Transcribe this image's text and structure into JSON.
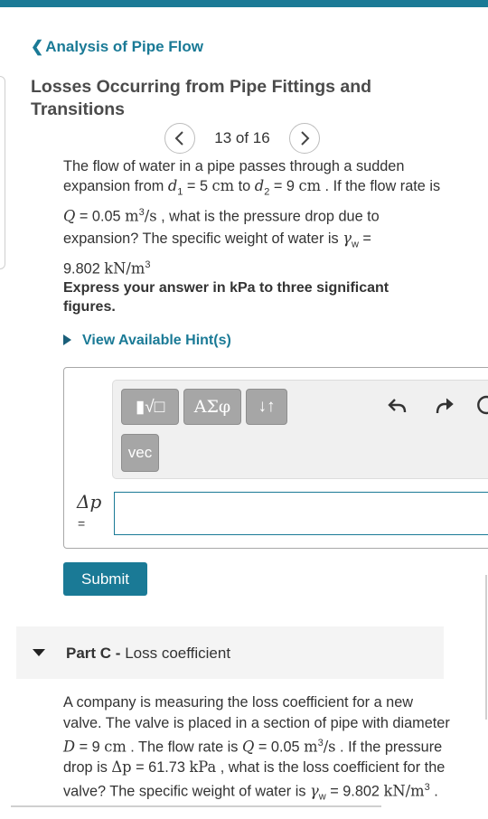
{
  "nav": {
    "back_label": "Analysis of Pipe Flow"
  },
  "page": {
    "title": "Losses Occurring from Pipe Fittings and Transitions"
  },
  "pager": {
    "count": "13 of 16",
    "prev_icon": "chevron-left-icon",
    "next_icon": "chevron-right-icon"
  },
  "problem": {
    "line1": "The flow of water in a pipe passes through a sudden",
    "s1": "expansion from ",
    "d1_var": "d",
    "d1_sub": "1",
    "d1_val": " = 5  ",
    "d1_unit": "cm",
    "s2": " to ",
    "d2_var": "d",
    "d2_sub": "2",
    "d2_val": " = 9  ",
    "d2_unit": "cm",
    "s3": " . If the flow rate is ",
    "q_var": "Q",
    "q_val": " = 0.05  ",
    "q_unit": "m",
    "q_exp": "3",
    "q_unit2": "/s",
    "s4": " , what is the pressure drop due to expansion? The specific weight of water is ",
    "gw_var": "γ",
    "gw_sub": "w",
    "gw_eq": " =",
    "gw_val": "9.802  ",
    "gw_unit": "kN/m",
    "gw_exp": "3"
  },
  "instructions": "Express your answer in kPa to three significant figures.",
  "hint_label": "View Available Hint(s)",
  "toolbar": {
    "templates_label": "▮√□",
    "greek_label": "ΑΣφ",
    "arrows_label": "↓↑",
    "vec_label": "vec",
    "undo_icon": "undo-icon",
    "redo_icon": "redo-icon",
    "reset_icon": "reset-icon"
  },
  "answer": {
    "var_label": "Δp",
    "eq": "=",
    "value": ""
  },
  "submit_label": "Submit",
  "part_c": {
    "part": "Part C -",
    "title": " Loss coefficient"
  },
  "problem_c": {
    "s1": "A company is measuring the loss coefficient for a new valve. The valve is placed in a section of pipe with diameter ",
    "d_var": "D",
    "d_val": " = 9  ",
    "d_unit": "cm",
    "s2": " . The flow rate is ",
    "q_var": "Q",
    "q_val": " = 0.05  ",
    "q_unit": "m",
    "q_exp": "3",
    "q_unit2": "/s",
    "s3": " . If the pressure drop is ",
    "dp_var": "Δp",
    "dp_val": " = 61.73  ",
    "dp_unit": "kPa",
    "s4": " , what is the loss coefficient for the valve? The specific weight of water is ",
    "gw_var": "γ",
    "gw_sub": "w",
    "gw_val": " = 9.802  ",
    "gw_unit": "kN/m",
    "gw_exp": "3",
    "s5": " ."
  }
}
